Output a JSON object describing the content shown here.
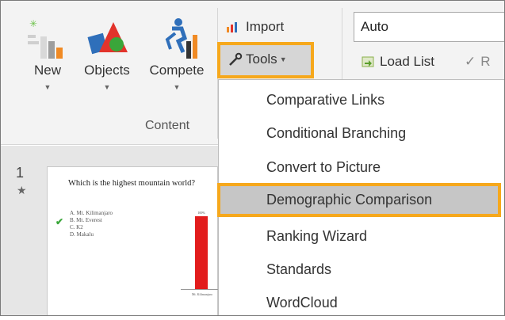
{
  "ribbon": {
    "new_label": "New",
    "objects_label": "Objects",
    "compete_label": "Compete",
    "content_group_label": "Content",
    "import_label": "Import",
    "tools_label": "Tools",
    "load_list_label": "Load List",
    "cut_letter": "R",
    "auto_value": "Auto",
    "arrow_glyph": "▼"
  },
  "menu": {
    "items": [
      {
        "label": "Comparative Links"
      },
      {
        "label": "Conditional Branching"
      },
      {
        "label": "Convert to Picture"
      },
      {
        "label": "Demographic Comparison"
      },
      {
        "label": "Ranking Wizard"
      },
      {
        "label": "Standards"
      },
      {
        "label": "WordCloud"
      }
    ],
    "highlighted_index": 3
  },
  "slide": {
    "number": "1",
    "question": "Which is the highest mountain world?",
    "options": [
      "A. Mt. Kilimanjaro",
      "B. Mt. Everest",
      "C. K2",
      "D. Makalu"
    ],
    "correct_index": 1,
    "bar_label": "Mt. Kilimanjaro",
    "bar_value_label": "100%"
  },
  "colors": {
    "highlight_border": "#f6a81c",
    "menu_highlight": "#c6c6c6",
    "bar_red": "#e21c1c",
    "check_green": "#3aa63a"
  }
}
